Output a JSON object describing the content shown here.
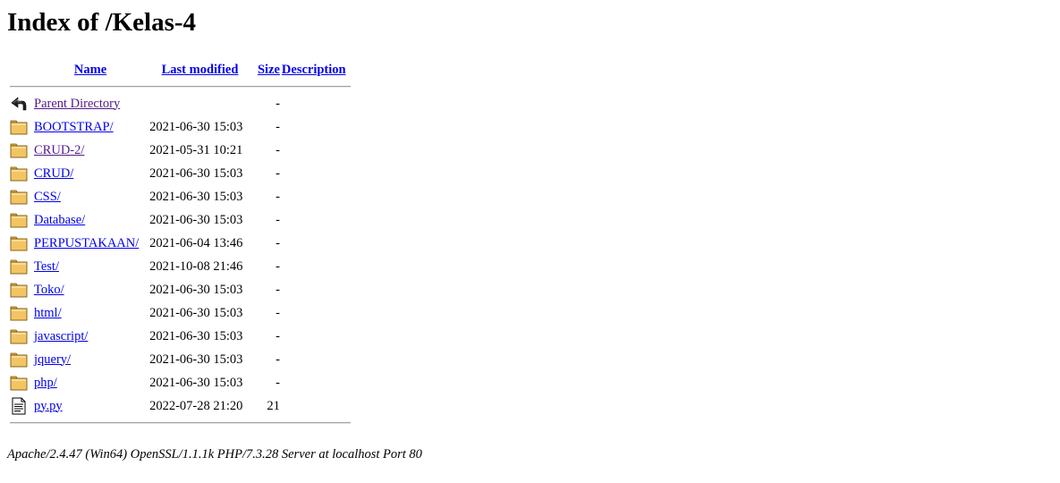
{
  "page": {
    "title": "Index of /Kelas-4"
  },
  "columns": {
    "name": "Name",
    "last_modified": "Last modified",
    "size": "Size",
    "description": "Description"
  },
  "entries": [
    {
      "icon": "back-icon",
      "name": "Parent Directory",
      "modified": "",
      "size": "-",
      "visited": true
    },
    {
      "icon": "folder-icon",
      "name": "BOOTSTRAP/",
      "modified": "2021-06-30 15:03",
      "size": "-",
      "visited": false
    },
    {
      "icon": "folder-icon",
      "name": "CRUD-2/",
      "modified": "2021-05-31 10:21",
      "size": "-",
      "visited": true
    },
    {
      "icon": "folder-icon",
      "name": "CRUD/",
      "modified": "2021-06-30 15:03",
      "size": "-",
      "visited": false
    },
    {
      "icon": "folder-icon",
      "name": "CSS/",
      "modified": "2021-06-30 15:03",
      "size": "-",
      "visited": false
    },
    {
      "icon": "folder-icon",
      "name": "Database/",
      "modified": "2021-06-30 15:03",
      "size": "-",
      "visited": false
    },
    {
      "icon": "folder-icon",
      "name": "PERPUSTAKAAN/",
      "modified": "2021-06-04 13:46",
      "size": "-",
      "visited": false
    },
    {
      "icon": "folder-icon",
      "name": "Test/",
      "modified": "2021-10-08 21:46",
      "size": "-",
      "visited": false
    },
    {
      "icon": "folder-icon",
      "name": "Toko/",
      "modified": "2021-06-30 15:03",
      "size": "-",
      "visited": false
    },
    {
      "icon": "folder-icon",
      "name": "html/",
      "modified": "2021-06-30 15:03",
      "size": "-",
      "visited": false
    },
    {
      "icon": "folder-icon",
      "name": "javascript/",
      "modified": "2021-06-30 15:03",
      "size": "-",
      "visited": false
    },
    {
      "icon": "folder-icon",
      "name": "jquery/",
      "modified": "2021-06-30 15:03",
      "size": "-",
      "visited": false
    },
    {
      "icon": "folder-icon",
      "name": "php/",
      "modified": "2021-06-30 15:03",
      "size": "-",
      "visited": false
    },
    {
      "icon": "text-file-icon",
      "name": "py.py",
      "modified": "2022-07-28 21:20",
      "size": "21",
      "visited": false
    }
  ],
  "footer": {
    "text": "Apache/2.4.47 (Win64) OpenSSL/1.1.1k PHP/7.3.28 Server at localhost Port 80"
  },
  "colors": {
    "link": "#0000ee",
    "visited": "#551a8b",
    "folder": "#f0c060"
  }
}
